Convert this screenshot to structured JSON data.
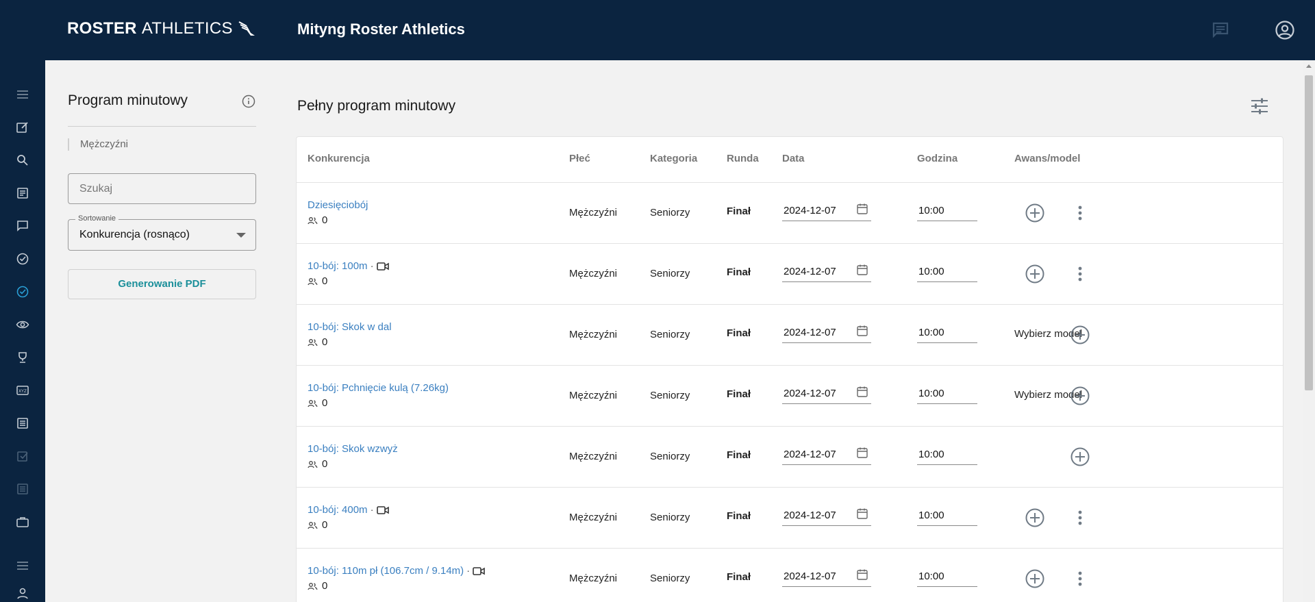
{
  "header": {
    "logo_bold": "ROSTER",
    "logo_light": "ATHLETICS",
    "title": "Mityng Roster Athletics",
    "chat_icon": "chat-icon",
    "account_icon": "account-circle-icon"
  },
  "sidebar": {
    "items": [
      {
        "icon": "menu-icon"
      },
      {
        "icon": "edit-icon"
      },
      {
        "icon": "search-icon"
      },
      {
        "icon": "article-icon"
      },
      {
        "icon": "chat-icon"
      },
      {
        "icon": "check-circle-icon"
      },
      {
        "icon": "check-circle-active-icon"
      },
      {
        "icon": "eye-icon"
      },
      {
        "icon": "trophy-icon"
      },
      {
        "icon": "xyz-icon"
      },
      {
        "icon": "list-icon"
      },
      {
        "icon": "checkbox-icon"
      },
      {
        "icon": "document-icon"
      },
      {
        "icon": "briefcase-icon"
      },
      {
        "icon": "menu-icon"
      },
      {
        "icon": "person-icon"
      }
    ]
  },
  "left_panel": {
    "title": "Program minutowy",
    "filter_chip": "Mężczyźni",
    "search_placeholder": "Szukaj",
    "sort_label": "Sortowanie",
    "sort_value": "Konkurencja (rosnąco)",
    "pdf_button": "Generowanie PDF"
  },
  "main": {
    "title": "Pełny program minutowy",
    "columns": [
      "Konkurencja",
      "Płeć",
      "Kategoria",
      "Runda",
      "Data",
      "Godzina",
      "Awans/model"
    ],
    "rows": [
      {
        "name": "Dziesięciobój",
        "video": false,
        "count": "0",
        "sex": "Mężczyźni",
        "category": "Seniorzy",
        "round": "Finał",
        "date": "2024-12-07",
        "time": "10:00",
        "model": "",
        "has_menu": true
      },
      {
        "name": "10-bój: 100m",
        "video": true,
        "count": "0",
        "sex": "Mężczyźni",
        "category": "Seniorzy",
        "round": "Finał",
        "date": "2024-12-07",
        "time": "10:00",
        "model": "",
        "has_menu": true
      },
      {
        "name": "10-bój: Skok w dal",
        "video": false,
        "count": "0",
        "sex": "Mężczyźni",
        "category": "Seniorzy",
        "round": "Finał",
        "date": "2024-12-07",
        "time": "10:00",
        "model": "Wybierz model",
        "has_menu": false
      },
      {
        "name": "10-bój: Pchnięcie kulą (7.26kg)",
        "video": false,
        "count": "0",
        "sex": "Mężczyźni",
        "category": "Seniorzy",
        "round": "Finał",
        "date": "2024-12-07",
        "time": "10:00",
        "model": "Wybierz model",
        "has_menu": false
      },
      {
        "name": "10-bój: Skok wzwyż",
        "video": false,
        "count": "0",
        "sex": "Mężczyźni",
        "category": "Seniorzy",
        "round": "Finał",
        "date": "2024-12-07",
        "time": "10:00",
        "model": "",
        "has_menu": false
      },
      {
        "name": "10-bój: 400m",
        "video": true,
        "count": "0",
        "sex": "Mężczyźni",
        "category": "Seniorzy",
        "round": "Finał",
        "date": "2024-12-07",
        "time": "10:00",
        "model": "",
        "has_menu": true
      },
      {
        "name": "10-bój: 110m pł (106.7cm / 9.14m)",
        "video": true,
        "count": "0",
        "sex": "Mężczyźni",
        "category": "Seniorzy",
        "round": "Finał",
        "date": "2024-12-07",
        "time": "10:00",
        "model": "",
        "has_menu": true
      }
    ]
  },
  "colors": {
    "header_bg": "#0b2440",
    "link": "#3a7fc0",
    "accent": "#1b8f9a",
    "icon_gray": "#6f7a85"
  }
}
